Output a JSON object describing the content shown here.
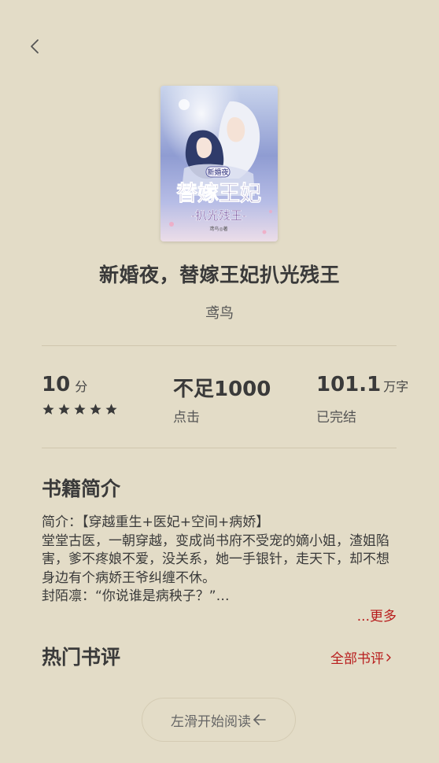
{
  "nav": {
    "back_icon": "chevron-left-icon"
  },
  "book": {
    "title": "新婚夜，替嫁王妃扒光残王",
    "author": "鸢鸟",
    "cover": {
      "top_text": "新婚夜",
      "main_text": "替嫁王妃",
      "sub_text": "-扒光残王-",
      "author_text": "鸢鸟◎著"
    }
  },
  "stats": {
    "score": {
      "value": "10",
      "unit": "分",
      "stars": 5
    },
    "clicks": {
      "value": "不足1000",
      "label": "点击"
    },
    "words": {
      "value": "101.1",
      "unit": "万字",
      "label": "已完结"
    }
  },
  "intro": {
    "heading": "书籍简介",
    "lines": [
      "简介：【穿越重生+医妃+空间+病娇】",
      "堂堂古医，一朝穿越，变成尚书府不受宠的嫡小姐，渣姐陷害，爹不疼娘不爱，没关系，她一手银针，走天下，却不想身边有个病娇王爷纠缠不休。",
      "封陌凛：“你说谁是病秧子？”…"
    ],
    "more_label": "...更多"
  },
  "reviews": {
    "heading": "热门书评",
    "all_label": "全部书评"
  },
  "read_button": {
    "label": "左滑开始阅读"
  },
  "colors": {
    "background": "#e3dcc7",
    "accent": "#b81c1c",
    "text": "#3a3a3a"
  }
}
